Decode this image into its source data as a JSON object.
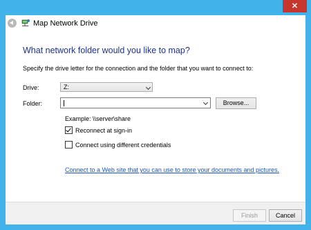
{
  "window": {
    "close_glyph": "✕",
    "colors": {
      "frame": "#41b3ea",
      "close": "#c7362c",
      "heading": "#1e3287",
      "link": "#1b58b8"
    }
  },
  "header": {
    "title": "Map Network Drive",
    "back_icon": "back-arrow-icon",
    "app_icon": "network-drive-icon"
  },
  "content": {
    "heading": "What network folder would you like to map?",
    "instructions": "Specify the drive letter for the connection and the folder that you want to connect to:",
    "drive_label": "Drive:",
    "drive_value": "Z:",
    "folder_label": "Folder:",
    "folder_value": "",
    "browse_label": "Browse...",
    "example": "Example: \\\\server\\share",
    "reconnect_label": "Reconnect at sign-in",
    "reconnect_checked": true,
    "credentials_label": "Connect using different credentials",
    "credentials_checked": false,
    "link_text": "Connect to a Web site that you can use to store your documents and pictures",
    "link_suffix": "."
  },
  "footer": {
    "finish_label": "Finish",
    "cancel_label": "Cancel"
  }
}
